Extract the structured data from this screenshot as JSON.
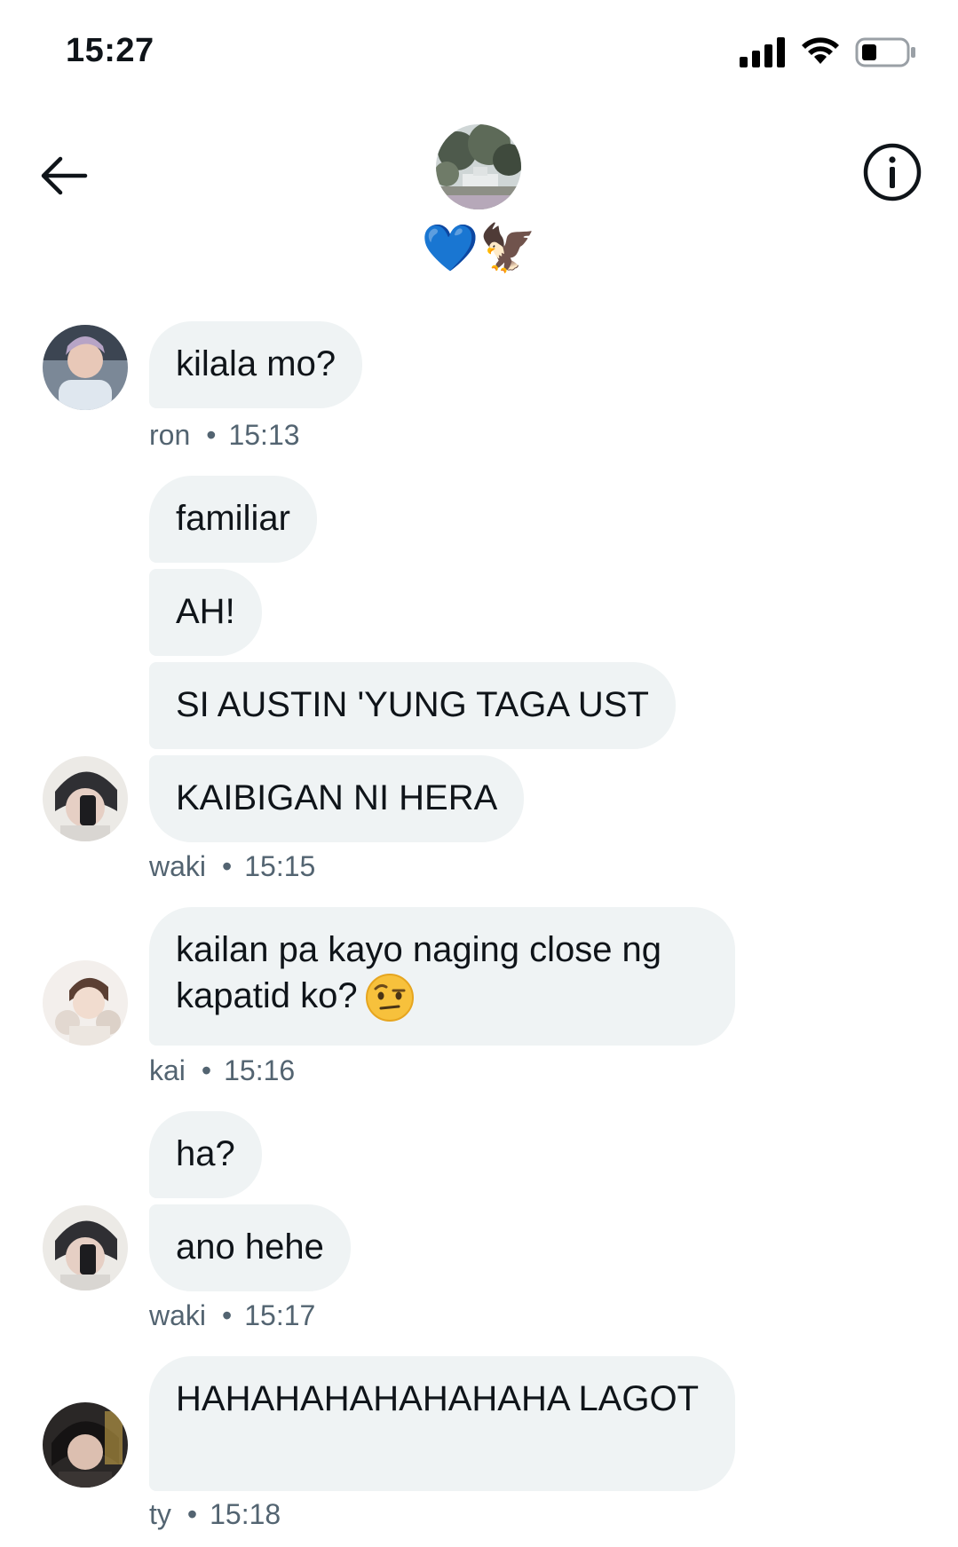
{
  "status_bar": {
    "time": "15:27"
  },
  "header": {
    "group_name": "💙🦅"
  },
  "messages": [
    {
      "text": "kilala mo?"
    },
    {
      "text": "familiar"
    },
    {
      "text": "AH!"
    },
    {
      "text": "SI AUSTIN 'YUNG TAGA UST"
    },
    {
      "text": "KAIBIGAN NI HERA"
    },
    {
      "text": "kailan pa kayo naging close ng kapatid ko?"
    },
    {
      "text": "ha?"
    },
    {
      "text": "ano hehe"
    },
    {
      "text": "HAHAHAHAHAHAHAHA LAGOT"
    }
  ],
  "meta": [
    {
      "sender": "ron",
      "time": "15:13"
    },
    {
      "sender": "waki",
      "time": "15:15"
    },
    {
      "sender": "kai",
      "time": "15:16"
    },
    {
      "sender": "waki",
      "time": "15:17"
    },
    {
      "sender": "ty",
      "time": "15:18"
    }
  ],
  "meta_separator": "•",
  "icons": [
    "signal-icon",
    "wifi-icon",
    "battery-icon",
    "back-arrow-icon",
    "info-icon",
    "raised-eyebrow-emoji"
  ]
}
